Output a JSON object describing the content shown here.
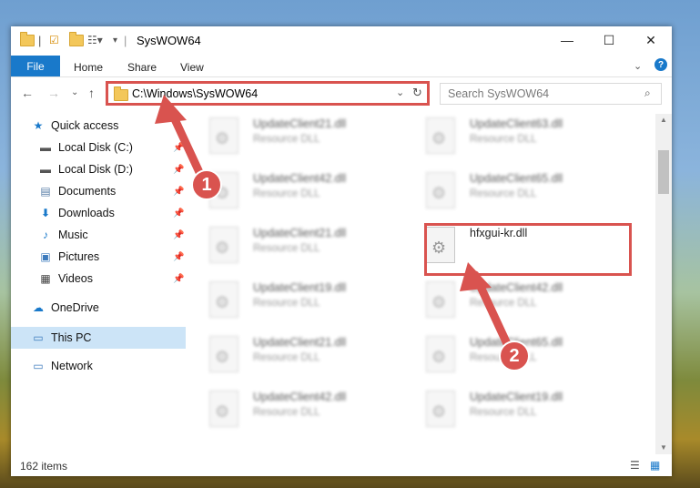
{
  "window": {
    "title": "SysWOW64",
    "controls": {
      "minimize": "—",
      "maximize": "☐",
      "close": "✕"
    }
  },
  "ribbon": {
    "file": "File",
    "tabs": [
      "Home",
      "Share",
      "View"
    ]
  },
  "address": {
    "path": "C:\\Windows\\SysWOW64"
  },
  "search": {
    "placeholder": "Search SysWOW64"
  },
  "nav": {
    "quick_access": "Quick access",
    "items": [
      {
        "label": "Local Disk (C:)",
        "icon": "drive-icon"
      },
      {
        "label": "Local Disk (D:)",
        "icon": "drive-icon"
      },
      {
        "label": "Documents",
        "icon": "document-icon"
      },
      {
        "label": "Downloads",
        "icon": "download-icon"
      },
      {
        "label": "Music",
        "icon": "music-icon"
      },
      {
        "label": "Pictures",
        "icon": "picture-icon"
      },
      {
        "label": "Videos",
        "icon": "video-icon"
      }
    ],
    "onedrive": "OneDrive",
    "this_pc": "This PC",
    "network": "Network"
  },
  "files": {
    "left": [
      {
        "name": "UpdateClient21.dll",
        "type": "Resource DLL"
      },
      {
        "name": "UpdateClient42.dll",
        "type": "Resource DLL"
      },
      {
        "name": "UpdateClient21.dll",
        "type": "Resource DLL"
      },
      {
        "name": "UpdateClient19.dll",
        "type": "Resource DLL"
      },
      {
        "name": "UpdateClient21.dll",
        "type": "Resource DLL"
      },
      {
        "name": "UpdateClient42.dll",
        "type": "Resource DLL"
      }
    ],
    "right": [
      {
        "name": "UpdateClient63.dll",
        "type": "Resource DLL"
      },
      {
        "name": "UpdateClient65.dll",
        "type": "Resource DLL"
      },
      {
        "name": "hfxgui-kr.dll",
        "type": ""
      },
      {
        "name": "UpdateClient42.dll",
        "type": "Resource DLL"
      },
      {
        "name": "UpdateClient65.dll",
        "type": "Resource DLL"
      },
      {
        "name": "UpdateClient19.dll",
        "type": "Resource DLL"
      }
    ]
  },
  "status": {
    "items": "162 items"
  },
  "annotations": {
    "step1": "1",
    "step2": "2"
  },
  "colors": {
    "accent": "#1979ca",
    "highlight": "#d9534f",
    "selection": "#cce4f7"
  }
}
